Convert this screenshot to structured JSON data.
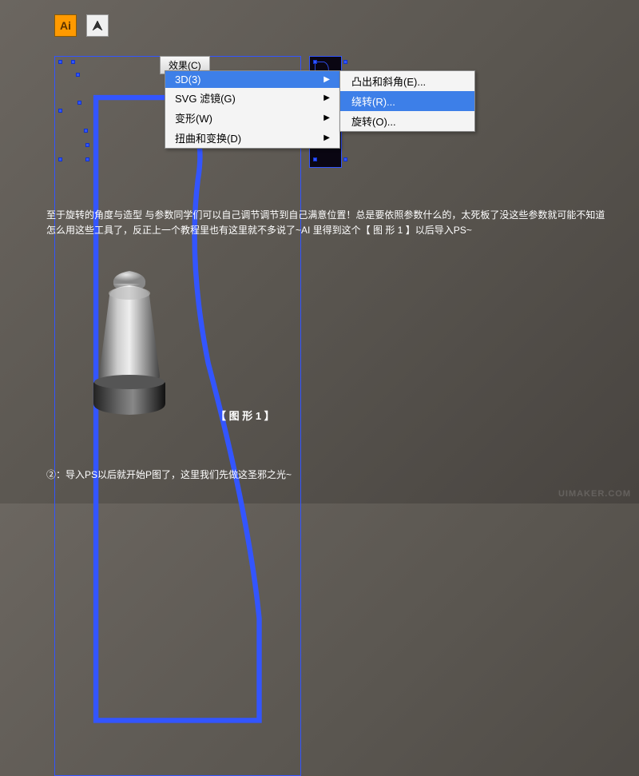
{
  "icons": {
    "ai_label": "Ai"
  },
  "menu_button": {
    "label": "效果(C)"
  },
  "dropdown": {
    "items": [
      {
        "label": "3D(3)",
        "highlighted": true
      },
      {
        "label": "SVG 滤镜(G)",
        "highlighted": false
      },
      {
        "label": "变形(W)",
        "highlighted": false
      },
      {
        "label": "扭曲和变换(D)",
        "highlighted": false
      }
    ]
  },
  "submenu": {
    "items": [
      {
        "label": "凸出和斜角(E)...",
        "highlighted": false
      },
      {
        "label": "绕转(R)...",
        "highlighted": true
      },
      {
        "label": "旋转(O)...",
        "highlighted": false
      }
    ]
  },
  "tutorial": {
    "line1": "至于旋转的角度与造型 与参数同学们可以自己调节调节到自己满意位置！总是要依照参数什么的，太死板了没这些参数就可能不知道怎么用这些工具了，反正上一个教程里也有这里就不多说了~AI 里得到这个【 图 形 1 】以后导入PS~"
  },
  "figure_label": "【 图 形 1 】",
  "bottom_text": "②：导入PS以后就开始P图了，这里我们先做这圣邪之光~",
  "watermark": "UIMAKER.COM"
}
